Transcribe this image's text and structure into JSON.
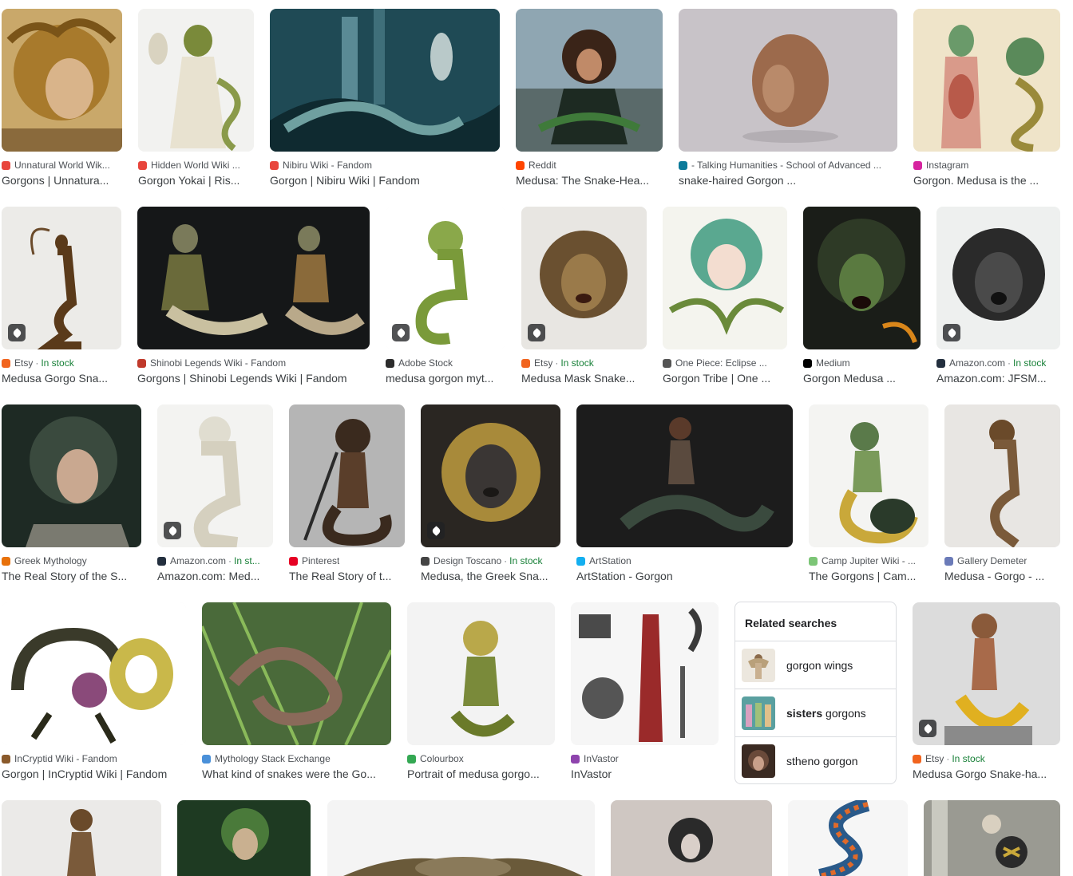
{
  "colors": {
    "source_text": "#4d5156",
    "title_text": "#3c4043",
    "in_stock": "#188038",
    "border": "#dadce0"
  },
  "results": [
    {
      "source": "Unnatural World Wik...",
      "stock": "",
      "title": "Gorgons | Unnatura...",
      "favicon": "#e8453c",
      "tag": false
    },
    {
      "source": "Hidden World Wiki ...",
      "stock": "",
      "title": "Gorgon Yokai | Ris...",
      "favicon": "#e8453c",
      "tag": false
    },
    {
      "source": "Nibiru Wiki - Fandom",
      "stock": "",
      "title": "Gorgon | Nibiru Wiki | Fandom",
      "favicon": "#e8453c",
      "tag": false
    },
    {
      "source": "Reddit",
      "stock": "",
      "title": "Medusa: The Snake-Hea...",
      "favicon": "#ff4500",
      "tag": false
    },
    {
      "source": "- Talking Humanities - School of Advanced ...",
      "stock": "",
      "title": "snake-haired Gorgon ...",
      "favicon": "#0b7a9a",
      "tag": false
    },
    {
      "source": "Instagram",
      "stock": "",
      "title": "Gorgon. Medusa is the ...",
      "favicon": "#d6249f",
      "tag": false
    },
    {
      "source": "Etsy",
      "stock": "In stock",
      "title": "Medusa Gorgo Sna...",
      "favicon": "#f1641e",
      "tag": true
    },
    {
      "source": "Shinobi Legends Wiki - Fandom",
      "stock": "",
      "title": "Gorgons | Shinobi Legends Wiki | Fandom",
      "favicon": "#c0392b",
      "tag": false
    },
    {
      "source": "Adobe Stock",
      "stock": "",
      "title": "medusa gorgon myt...",
      "favicon": "#2c2c2c",
      "tag": true
    },
    {
      "source": "Etsy",
      "stock": "In stock",
      "title": "Medusa Mask Snake...",
      "favicon": "#f1641e",
      "tag": true
    },
    {
      "source": "One Piece: Eclipse ...",
      "stock": "",
      "title": "Gorgon Tribe | One ...",
      "favicon": "#555555",
      "tag": false
    },
    {
      "source": "Medium",
      "stock": "",
      "title": "Gorgon Medusa ...",
      "favicon": "#000000",
      "tag": false
    },
    {
      "source": "Amazon.com",
      "stock": "In stock",
      "title": "Amazon.com: JFSM...",
      "favicon": "#232f3e",
      "tag": true
    },
    {
      "source": "Greek Mythology",
      "stock": "",
      "title": "The Real Story of the S...",
      "favicon": "#e8710a",
      "tag": false
    },
    {
      "source": "Amazon.com",
      "stock": "In st...",
      "title": "Amazon.com: Med...",
      "favicon": "#232f3e",
      "tag": true
    },
    {
      "source": "Pinterest",
      "stock": "",
      "title": "The Real Story of t...",
      "favicon": "#e60023",
      "tag": false
    },
    {
      "source": "Design Toscano",
      "stock": "In stock",
      "title": "Medusa, the Greek Sna...",
      "favicon": "#444444",
      "tag": true
    },
    {
      "source": "ArtStation",
      "stock": "",
      "title": "ArtStation - Gorgon",
      "favicon": "#13aff0",
      "tag": false
    },
    {
      "source": "Camp Jupiter Wiki - ...",
      "stock": "",
      "title": "The Gorgons | Cam...",
      "favicon": "#7cc576",
      "tag": false
    },
    {
      "source": "Gallery Demeter",
      "stock": "",
      "title": "Medusa - Gorgo - ...",
      "favicon": "#6b7bb8",
      "tag": false
    },
    {
      "source": "InCryptid Wiki - Fandom",
      "stock": "",
      "title": "Gorgon | InCryptid Wiki | Fandom",
      "favicon": "#8a5a2b",
      "tag": false
    },
    {
      "source": "Mythology Stack Exchange",
      "stock": "",
      "title": "What kind of snakes were the Go...",
      "favicon": "#4a90d9",
      "tag": false
    },
    {
      "source": "Colourbox",
      "stock": "",
      "title": "Portrait of medusa gorgo...",
      "favicon": "#34a853",
      "tag": false
    },
    {
      "source": "InVastor",
      "stock": "",
      "title": "InVastor",
      "favicon": "#8e44ad",
      "tag": false
    },
    {
      "source": "Etsy",
      "stock": "In stock",
      "title": "Medusa Gorgo Snake-ha...",
      "favicon": "#f1641e",
      "tag": true
    }
  ],
  "related_searches": {
    "heading": "Related searches",
    "items": [
      {
        "prefix": "",
        "bold": "",
        "suffix": "gorgon wings"
      },
      {
        "prefix": "",
        "bold": "sisters",
        "suffix": " gorgons"
      },
      {
        "prefix": "",
        "bold": "",
        "suffix": "stheno gorgon"
      }
    ]
  }
}
